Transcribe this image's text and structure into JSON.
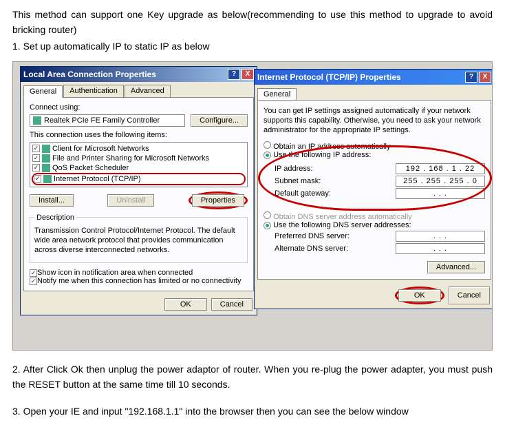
{
  "intro_text": "This method can support one Key upgrade as below(recommending to use this method to upgrade to avoid bricking router)",
  "step1": "1.  Set up automatically IP to static IP as below",
  "left_dialog": {
    "title": "Local Area Connection Properties",
    "tabs": [
      "General",
      "Authentication",
      "Advanced"
    ],
    "connect_using_label": "Connect using:",
    "adapter": "Realtek PCIe FE Family Controller",
    "configure_btn": "Configure...",
    "uses_items_label": "This connection uses the following items:",
    "items": [
      "Client for Microsoft Networks",
      "File and Printer Sharing for Microsoft Networks",
      "QoS Packet Scheduler",
      "Internet Protocol (TCP/IP)"
    ],
    "install_btn": "Install...",
    "uninstall_btn": "Uninstall",
    "properties_btn": "Properties",
    "description_label": "Description",
    "description_text": "Transmission Control Protocol/Internet Protocol. The default wide area network protocol that provides communication across diverse interconnected networks.",
    "show_icon": "Show icon in notification area when connected",
    "notify_limited": "Notify me when this connection has limited or no connectivity",
    "ok_btn": "OK",
    "cancel_btn": "Cancel"
  },
  "right_dialog": {
    "title": "Internet Protocol (TCP/IP) Properties",
    "tab": "General",
    "intro": "You can get IP settings assigned automatically if your network supports this capability. Otherwise, you need to ask your network administrator for the appropriate IP settings.",
    "auto_ip": "Obtain an IP address automatically",
    "use_ip": "Use the following IP address:",
    "ip_label": "IP address:",
    "ip_value": "192 . 168 .  1  .  22",
    "subnet_label": "Subnet mask:",
    "subnet_value": "255 . 255 . 255 .  0",
    "gateway_label": "Default gateway:",
    "gateway_value": " .       .       . ",
    "auto_dns": "Obtain DNS server address automatically",
    "use_dns": "Use the following DNS server addresses:",
    "pref_dns_label": "Preferred DNS server:",
    "pref_dns_value": " .       .       . ",
    "alt_dns_label": "Alternate DNS server:",
    "alt_dns_value": " .       .       . ",
    "advanced_btn": "Advanced...",
    "ok_btn": "OK",
    "cancel_btn": "Cancel"
  },
  "step2": "2. After Click Ok    then unplug the power adaptor of router. When you re-plug the power adapter, you must push the RESET button at the same time till 10 seconds.",
  "step3": "3. Open your IE and input \"192.168.1.1\" into the browser    then you can see the below window"
}
